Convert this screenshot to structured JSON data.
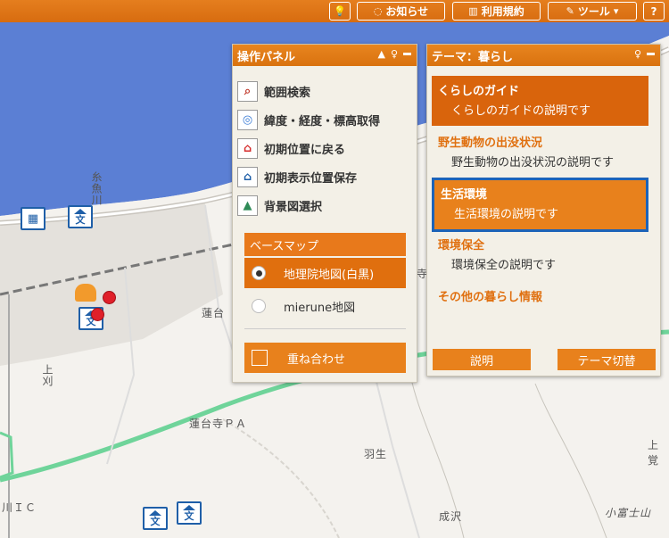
{
  "toolbar": {
    "pin_icon": "lightbulb-icon",
    "notice_label": "お知らせ",
    "terms_label": "利用規約",
    "tools_label": "ツール",
    "help_label": "?"
  },
  "operation_panel": {
    "title": "操作パネル",
    "items": [
      {
        "label": "範囲検索",
        "icon": "magnifier-icon"
      },
      {
        "label": "緯度・経度・標高取得",
        "icon": "target-icon"
      },
      {
        "label": "初期位置に戻る",
        "icon": "home-icon"
      },
      {
        "label": "初期表示位置保存",
        "icon": "home-save-icon"
      },
      {
        "label": "背景図選択",
        "icon": "landscape-icon"
      }
    ],
    "basemap_header": "ベースマップ",
    "basemaps": [
      {
        "label": "地理院地図(白黒)",
        "selected": true
      },
      {
        "label": "mierune地図",
        "selected": false
      }
    ],
    "overlay_label": "重ね合わせ"
  },
  "theme_panel": {
    "title": "テーマ：暮らし",
    "items": [
      {
        "title": "くらしのガイド",
        "desc": "くらしのガイドの説明です"
      },
      {
        "title": "野生動物の出没状況",
        "desc": "野生動物の出没状況の説明です"
      },
      {
        "title": "生活環境",
        "desc": "生活環境の説明です"
      },
      {
        "title": "環境保全",
        "desc": "環境保全の説明です"
      },
      {
        "title": "その他の暮らし情報",
        "desc": ""
      }
    ],
    "explain_label": "説明",
    "switch_label": "テーマ切替"
  },
  "map": {
    "labels": {
      "itoigawa": "糸魚川",
      "rendai": "蓮台",
      "kamikari": "上刈",
      "rendaiji_pa": "蓮台寺ＰＡ",
      "hanyu": "羽生",
      "ic": "川ＩＣ",
      "narusawa": "成沢",
      "kofuji": "小富士山",
      "kamihaya": "上覚",
      "teraji": "寺町"
    }
  },
  "colors": {
    "accent": "#e8811c",
    "sea": "#5b7fd4",
    "road": "#6fd49a",
    "selected_border": "#1c63b8"
  }
}
